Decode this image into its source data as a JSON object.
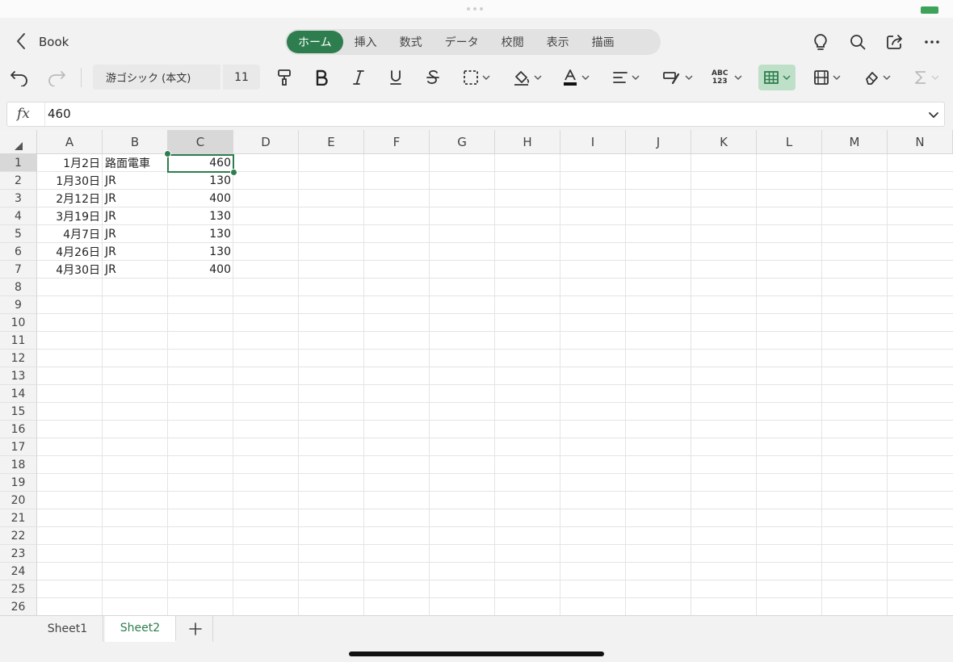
{
  "app": {
    "back_icon": "chevron-left-icon",
    "title": "Book"
  },
  "ribbon_tabs": [
    {
      "label": "ホーム",
      "active": true
    },
    {
      "label": "挿入",
      "active": false
    },
    {
      "label": "数式",
      "active": false
    },
    {
      "label": "データ",
      "active": false
    },
    {
      "label": "校閲",
      "active": false
    },
    {
      "label": "表示",
      "active": false
    },
    {
      "label": "描画",
      "active": false
    }
  ],
  "top_actions": [
    "lightbulb-icon",
    "search-icon",
    "share-icon",
    "more-icon"
  ],
  "toolbar": {
    "font_name": "游ゴシック (本文)",
    "font_size": "11",
    "spelling_label_top": "ABC",
    "spelling_label_bottom": "123"
  },
  "formula_bar": {
    "fx_label": "fx",
    "value": "460"
  },
  "grid": {
    "columns": [
      "A",
      "B",
      "C",
      "D",
      "E",
      "F",
      "G",
      "H",
      "I",
      "J",
      "K",
      "L",
      "M",
      "N"
    ],
    "row_count": 26,
    "selected_cell": "C1",
    "rows": [
      {
        "a": "1月2日",
        "b": "路面電車",
        "c": "460"
      },
      {
        "a": "1月30日",
        "b": "JR",
        "c": "130"
      },
      {
        "a": "2月12日",
        "b": "JR",
        "c": "400"
      },
      {
        "a": "3月19日",
        "b": "JR",
        "c": "130"
      },
      {
        "a": "4月7日",
        "b": "JR",
        "c": "130"
      },
      {
        "a": "4月26日",
        "b": "JR",
        "c": "130"
      },
      {
        "a": "4月30日",
        "b": "JR",
        "c": "400"
      }
    ]
  },
  "sheets": [
    {
      "label": "Sheet1",
      "active": false
    },
    {
      "label": "Sheet2",
      "active": true
    }
  ],
  "add_sheet_icon": "plus-icon",
  "colors": {
    "accent": "#2e7d4f",
    "accent_light": "#bfe0c8"
  }
}
